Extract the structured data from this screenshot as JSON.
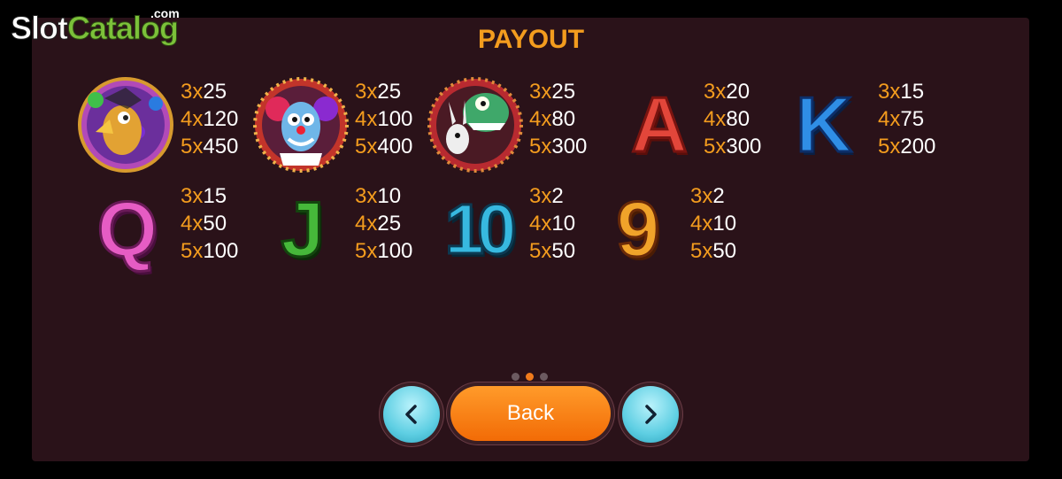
{
  "logo": {
    "slot": "Slot",
    "catalog": "Catalog",
    "dotcom": ".com"
  },
  "title": "PAYOUT",
  "symbols": [
    {
      "name": "bird-jester",
      "pays": [
        {
          "count": "3x",
          "value": "25"
        },
        {
          "count": "4x",
          "value": "120"
        },
        {
          "count": "5x",
          "value": "450"
        }
      ]
    },
    {
      "name": "clown",
      "pays": [
        {
          "count": "3x",
          "value": "25"
        },
        {
          "count": "4x",
          "value": "100"
        },
        {
          "count": "5x",
          "value": "400"
        }
      ]
    },
    {
      "name": "monster-rabbit",
      "pays": [
        {
          "count": "3x",
          "value": "25"
        },
        {
          "count": "4x",
          "value": "80"
        },
        {
          "count": "5x",
          "value": "300"
        }
      ]
    },
    {
      "name": "letter-a",
      "glyph": "A",
      "pays": [
        {
          "count": "3x",
          "value": "20"
        },
        {
          "count": "4x",
          "value": "80"
        },
        {
          "count": "5x",
          "value": "300"
        }
      ]
    },
    {
      "name": "letter-k",
      "glyph": "K",
      "pays": [
        {
          "count": "3x",
          "value": "15"
        },
        {
          "count": "4x",
          "value": "75"
        },
        {
          "count": "5x",
          "value": "200"
        }
      ]
    },
    {
      "name": "letter-q",
      "glyph": "Q",
      "pays": [
        {
          "count": "3x",
          "value": "15"
        },
        {
          "count": "4x",
          "value": "50"
        },
        {
          "count": "5x",
          "value": "100"
        }
      ]
    },
    {
      "name": "letter-j",
      "glyph": "J",
      "pays": [
        {
          "count": "3x",
          "value": "10"
        },
        {
          "count": "4x",
          "value": "25"
        },
        {
          "count": "5x",
          "value": "100"
        }
      ]
    },
    {
      "name": "number-10",
      "glyph": "10",
      "pays": [
        {
          "count": "3x",
          "value": "2"
        },
        {
          "count": "4x",
          "value": "10"
        },
        {
          "count": "5x",
          "value": "50"
        }
      ]
    },
    {
      "name": "number-9",
      "glyph": "9",
      "pays": [
        {
          "count": "3x",
          "value": "2"
        },
        {
          "count": "4x",
          "value": "10"
        },
        {
          "count": "5x",
          "value": "50"
        }
      ]
    }
  ],
  "pagination": {
    "pages": 3,
    "current": 2
  },
  "buttons": {
    "back_label": "Back",
    "prev_icon": "chevron-left-icon",
    "next_icon": "chevron-right-icon"
  },
  "colors": {
    "accent": "#f39c1e",
    "panel": "#2a1219",
    "letter_a": "#e2463a",
    "letter_k": "#2f8ee6",
    "letter_q": "#e65cc4",
    "letter_j": "#46b83a",
    "number_10": "#37b9e0",
    "number_9": "#f0a32a"
  }
}
